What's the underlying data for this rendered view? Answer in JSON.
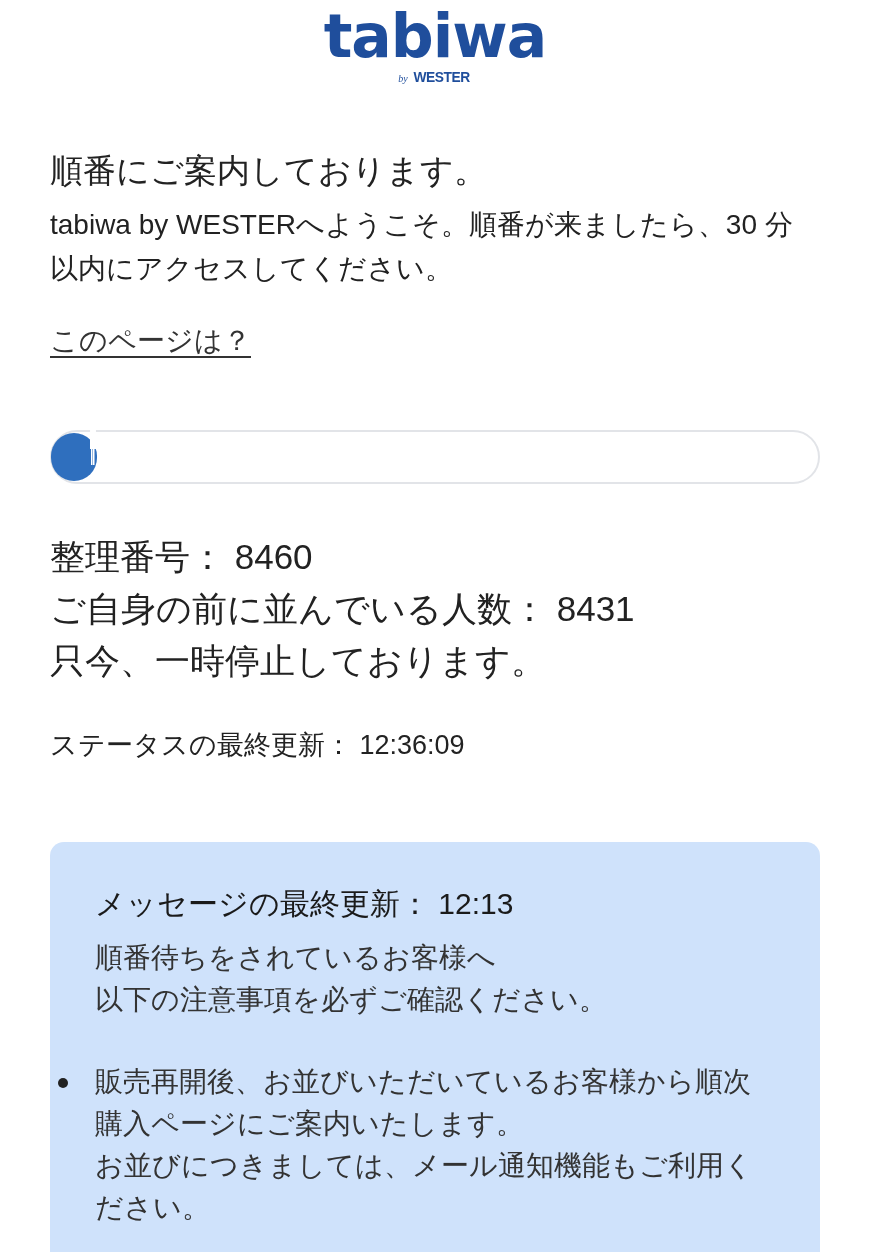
{
  "logo": {
    "wordmark": "tabiwa",
    "by": "by",
    "brand": "WESTER"
  },
  "heading": "順番にご案内しております。",
  "intro": "tabiwa by WESTERへようこそ。順番が来ましたら、30 分以内にアクセスしてください。",
  "help_link": "このページは？",
  "progress": {
    "level": 0.06
  },
  "ticket_lines": [
    "整理番号： 8460",
    "ご自身の前に並んでいる人数： 8431",
    "只今、一時停止しております。"
  ],
  "status_update": "ステータスの最終更新： 12:36:09",
  "message": {
    "updated": "メッセージの最終更新： 12:13",
    "greeting": [
      "順番待ちをされているお客様へ",
      "以下の注意事項を必ずご確認ください。"
    ],
    "notes": [
      {
        "paragraphs": [
          "販売再開後、お並びいただいているお客様から順次購入ページにご案内いたします。",
          "お並びにつきましては、メール通知機能もご利用ください。"
        ]
      }
    ]
  }
}
